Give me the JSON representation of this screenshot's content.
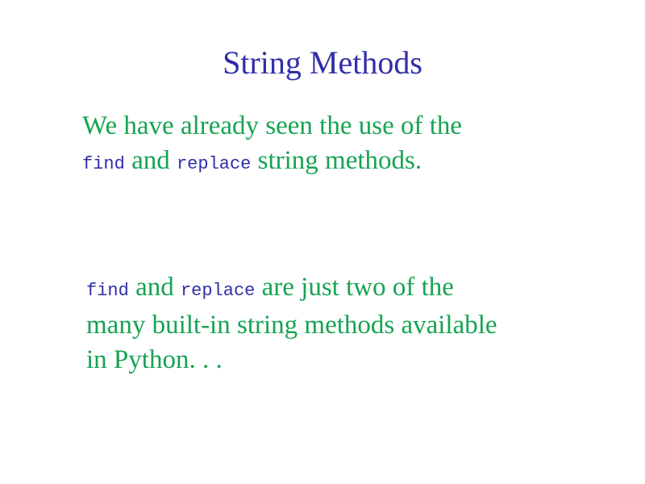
{
  "slide": {
    "title": "String Methods",
    "paragraph1": {
      "line1": "We have already seen the use of the",
      "code_find": "find",
      "and_text": " and ",
      "code_replace": "replace",
      "line2_tail": " string methods."
    },
    "paragraph2": {
      "code_find": "find",
      "and_text": " and ",
      "code_replace": "replace",
      "line1_tail": " are just two of the",
      "line2": "many built-in string methods available",
      "line3": "in Python. . ."
    }
  },
  "colors": {
    "title": "#2f2fa8",
    "body_text": "#16a352",
    "code_text": "#2f2fa8",
    "background": "#ffffff"
  }
}
